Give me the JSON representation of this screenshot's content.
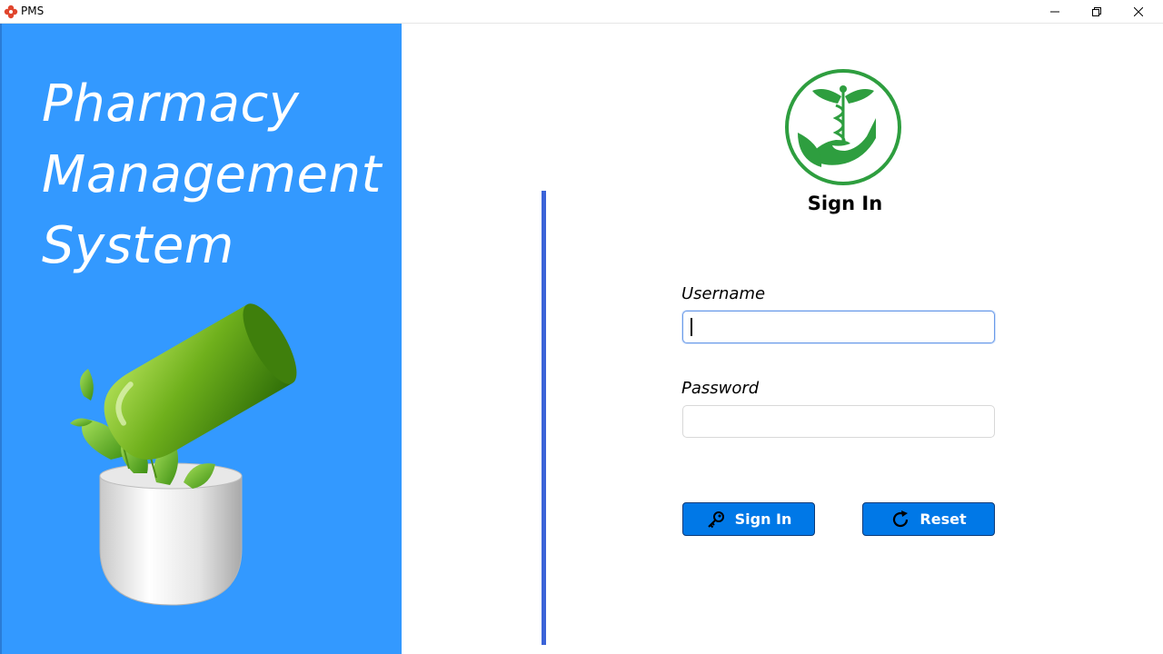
{
  "window": {
    "title": "PMS"
  },
  "brand": {
    "line1": "Pharmacy",
    "line2": "Management",
    "line3": "System",
    "panel_color": "#3399ff"
  },
  "login": {
    "heading": "Sign In",
    "username_label": "Username",
    "username_value": "",
    "password_label": "Password",
    "password_value": "",
    "signin_button": "Sign In",
    "reset_button": "Reset",
    "button_color": "#0078e7",
    "divider_color": "#3b63d8",
    "logo_color": "#2e9e3f"
  },
  "icons": {
    "app": "medical-cross-icon",
    "signin": "key-icon",
    "reset": "refresh-icon",
    "minimize": "minimize-icon",
    "maximize": "restore-icon",
    "close": "close-icon"
  }
}
